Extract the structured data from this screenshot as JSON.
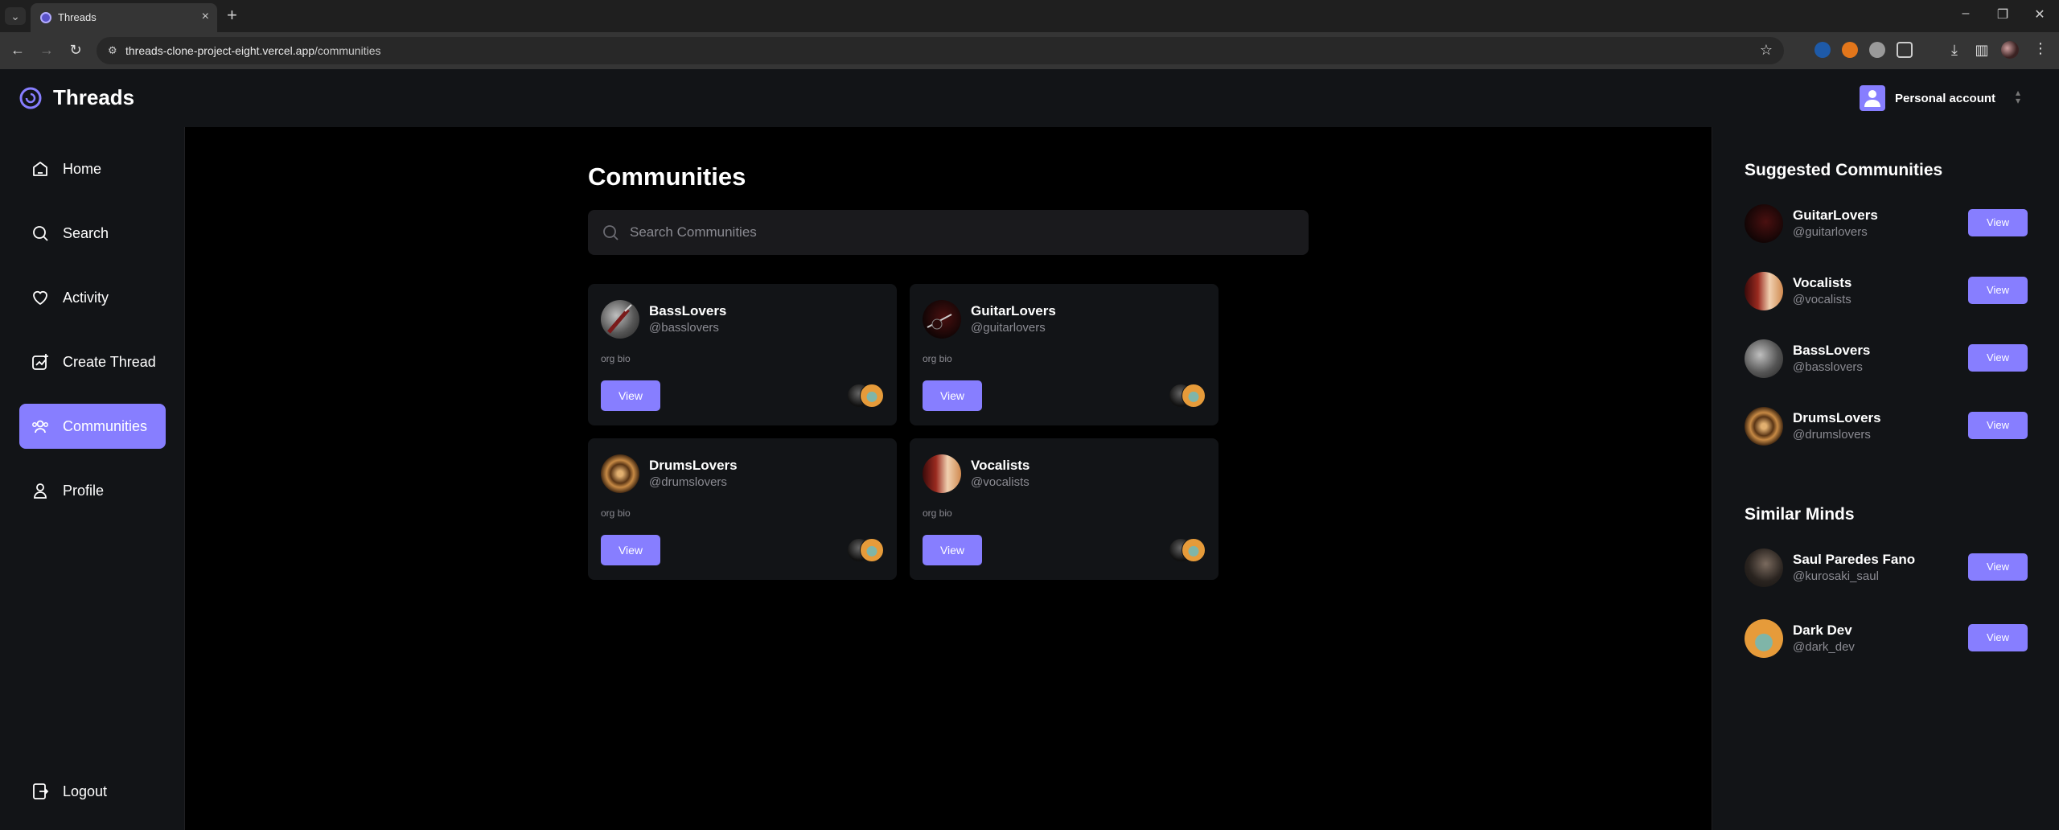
{
  "browser": {
    "tab_title": "Threads",
    "url_host": "threads-clone-project-eight.vercel.app",
    "url_path": "/communities"
  },
  "app": {
    "title": "Threads",
    "account_label": "Personal account"
  },
  "sidebar": {
    "items": [
      {
        "label": "Home",
        "icon": "home-icon",
        "active": false
      },
      {
        "label": "Search",
        "icon": "search-icon",
        "active": false
      },
      {
        "label": "Activity",
        "icon": "heart-icon",
        "active": false
      },
      {
        "label": "Create Thread",
        "icon": "create-icon",
        "active": false
      },
      {
        "label": "Communities",
        "icon": "community-icon",
        "active": true
      },
      {
        "label": "Profile",
        "icon": "user-icon",
        "active": false
      }
    ],
    "logout": {
      "label": "Logout",
      "icon": "logout-icon"
    }
  },
  "main": {
    "title": "Communities",
    "search_placeholder": "Search Communities",
    "cards": [
      {
        "name": "BassLovers",
        "handle": "@basslovers",
        "bio": "org bio",
        "button": "View"
      },
      {
        "name": "GuitarLovers",
        "handle": "@guitarlovers",
        "bio": "org bio",
        "button": "View"
      },
      {
        "name": "DrumsLovers",
        "handle": "@drumslovers",
        "bio": "org bio",
        "button": "View"
      },
      {
        "name": "Vocalists",
        "handle": "@vocalists",
        "bio": "org bio",
        "button": "View"
      }
    ]
  },
  "rightbar": {
    "suggested_title": "Suggested Communities",
    "suggested": [
      {
        "name": "GuitarLovers",
        "handle": "@guitarlovers",
        "button": "View"
      },
      {
        "name": "Vocalists",
        "handle": "@vocalists",
        "button": "View"
      },
      {
        "name": "BassLovers",
        "handle": "@basslovers",
        "button": "View"
      },
      {
        "name": "DrumsLovers",
        "handle": "@drumslovers",
        "button": "View"
      }
    ],
    "similar_title": "Similar Minds",
    "similar": [
      {
        "name": "Saul Paredes Fano",
        "handle": "@kurosaki_saul",
        "button": "View"
      },
      {
        "name": "Dark Dev",
        "handle": "@dark_dev",
        "button": "View"
      }
    ]
  },
  "colors": {
    "accent": "#877eff",
    "panel": "#121417",
    "background": "#000000",
    "muted_text": "#8b8b92"
  }
}
